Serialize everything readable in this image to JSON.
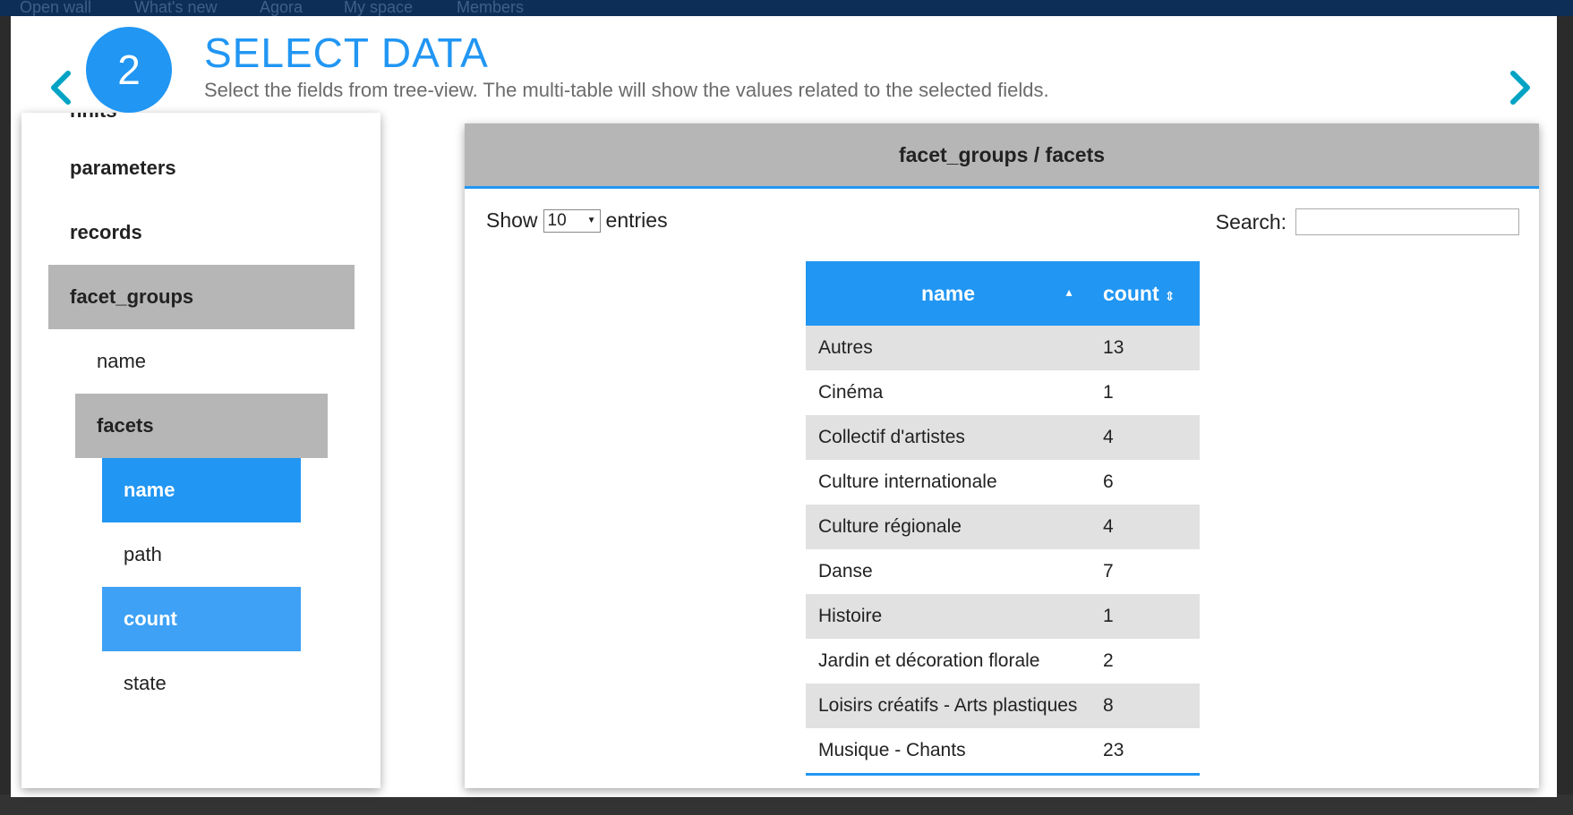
{
  "step": {
    "number": "2",
    "title": "SELECT DATA",
    "subtitle": "Select the fields from tree-view. The multi-table will show the values related to the selected fields."
  },
  "tree": {
    "items": [
      {
        "label": "nhits",
        "style": "bold"
      },
      {
        "label": "parameters",
        "style": "bold"
      },
      {
        "label": "records",
        "style": "bold"
      },
      {
        "label": "facet_groups",
        "style": "group"
      },
      {
        "label": "name",
        "style": "plain"
      },
      {
        "label": "facets",
        "style": "group"
      },
      {
        "label": "name",
        "style": "selected"
      },
      {
        "label": "path",
        "style": "plain"
      },
      {
        "label": "count",
        "style": "selected"
      },
      {
        "label": "state",
        "style": "plain"
      }
    ]
  },
  "table_panel": {
    "title": "facet_groups / facets",
    "show_label": "Show",
    "entries_value": "10",
    "entries_label": "entries",
    "search_label": "Search:",
    "search_value": "",
    "columns": [
      "name",
      "count"
    ],
    "rows": [
      {
        "name": "Autres",
        "count": "13"
      },
      {
        "name": "Cinéma",
        "count": "1"
      },
      {
        "name": "Collectif d'artistes",
        "count": "4"
      },
      {
        "name": "Culture internationale",
        "count": "6"
      },
      {
        "name": "Culture régionale",
        "count": "4"
      },
      {
        "name": "Danse",
        "count": "7"
      },
      {
        "name": "Histoire",
        "count": "1"
      },
      {
        "name": "Jardin et décoration florale",
        "count": "2"
      },
      {
        "name": "Loisirs créatifs - Arts plastiques",
        "count": "8"
      },
      {
        "name": "Musique - Chants",
        "count": "23"
      }
    ]
  },
  "background": {
    "nav_items": [
      "Open wall",
      "What's new",
      "Agora",
      "My space",
      "Members"
    ]
  },
  "colors": {
    "accent": "#2196f3",
    "arrow": "#00a3c4",
    "group_bg": "#b6b6b6"
  }
}
